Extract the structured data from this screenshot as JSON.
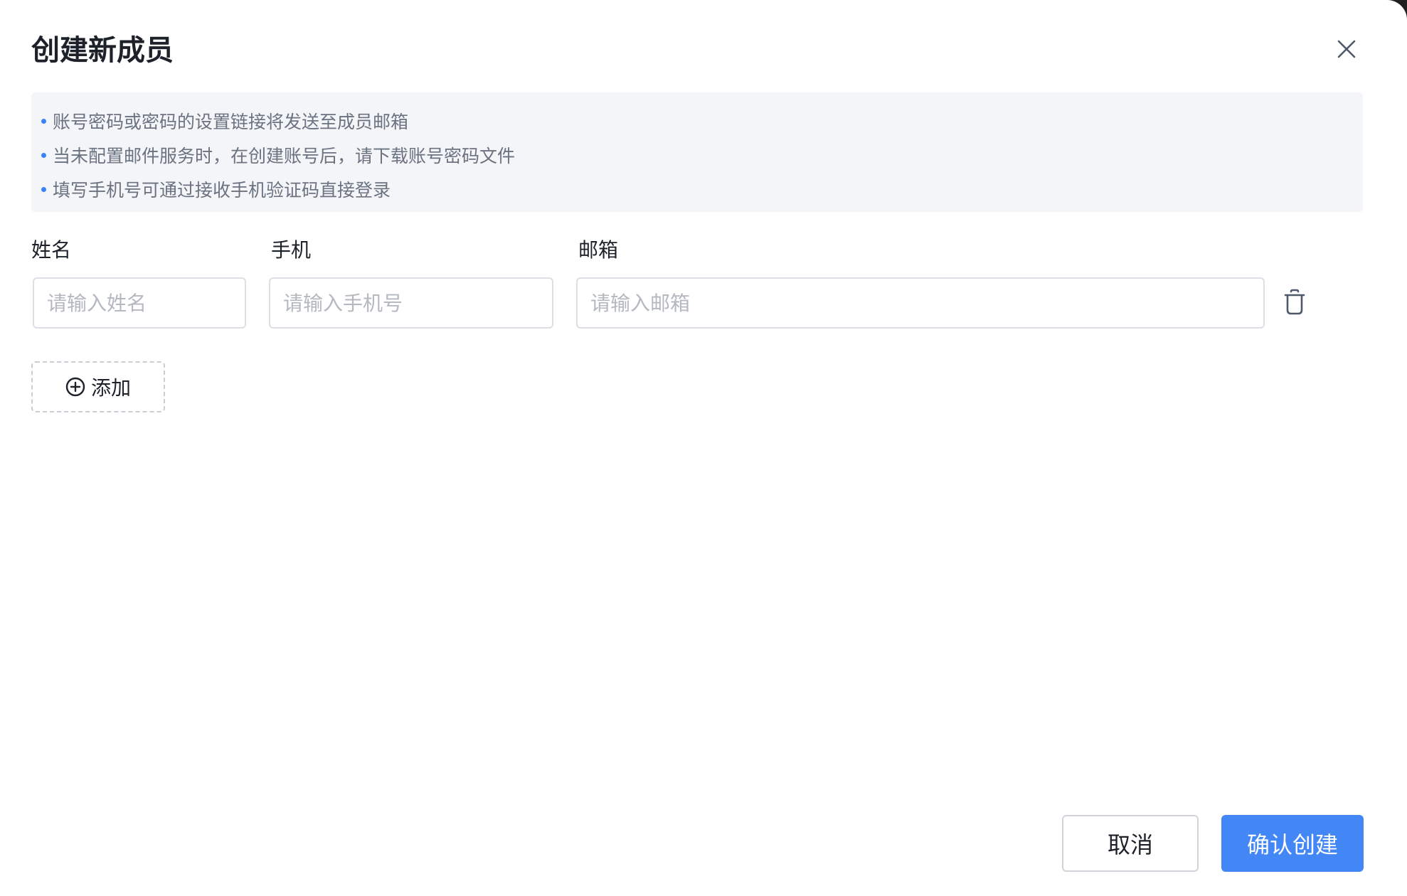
{
  "dialog": {
    "title": "创建新成员"
  },
  "notice": {
    "items": [
      "账号密码或密码的设置链接将发送至成员邮箱",
      "当未配置邮件服务时，在创建账号后，请下载账号密码文件",
      "填写手机号可通过接收手机验证码直接登录"
    ]
  },
  "form": {
    "name_label": "姓名",
    "phone_label": "手机",
    "email_label": "邮箱",
    "name_placeholder": "请输入姓名",
    "phone_placeholder": "请输入手机号",
    "email_placeholder": "请输入邮箱",
    "name_value": "",
    "phone_value": "",
    "email_value": ""
  },
  "actions": {
    "add_label": "添加",
    "cancel_label": "取消",
    "confirm_label": "确认创建"
  },
  "icons": {
    "close": "close-icon",
    "delete": "trash-icon",
    "add": "plus-circle-icon"
  },
  "colors": {
    "primary": "#4287f5",
    "bullet": "#3b82f6",
    "notice_bg": "#f3f5f8"
  }
}
